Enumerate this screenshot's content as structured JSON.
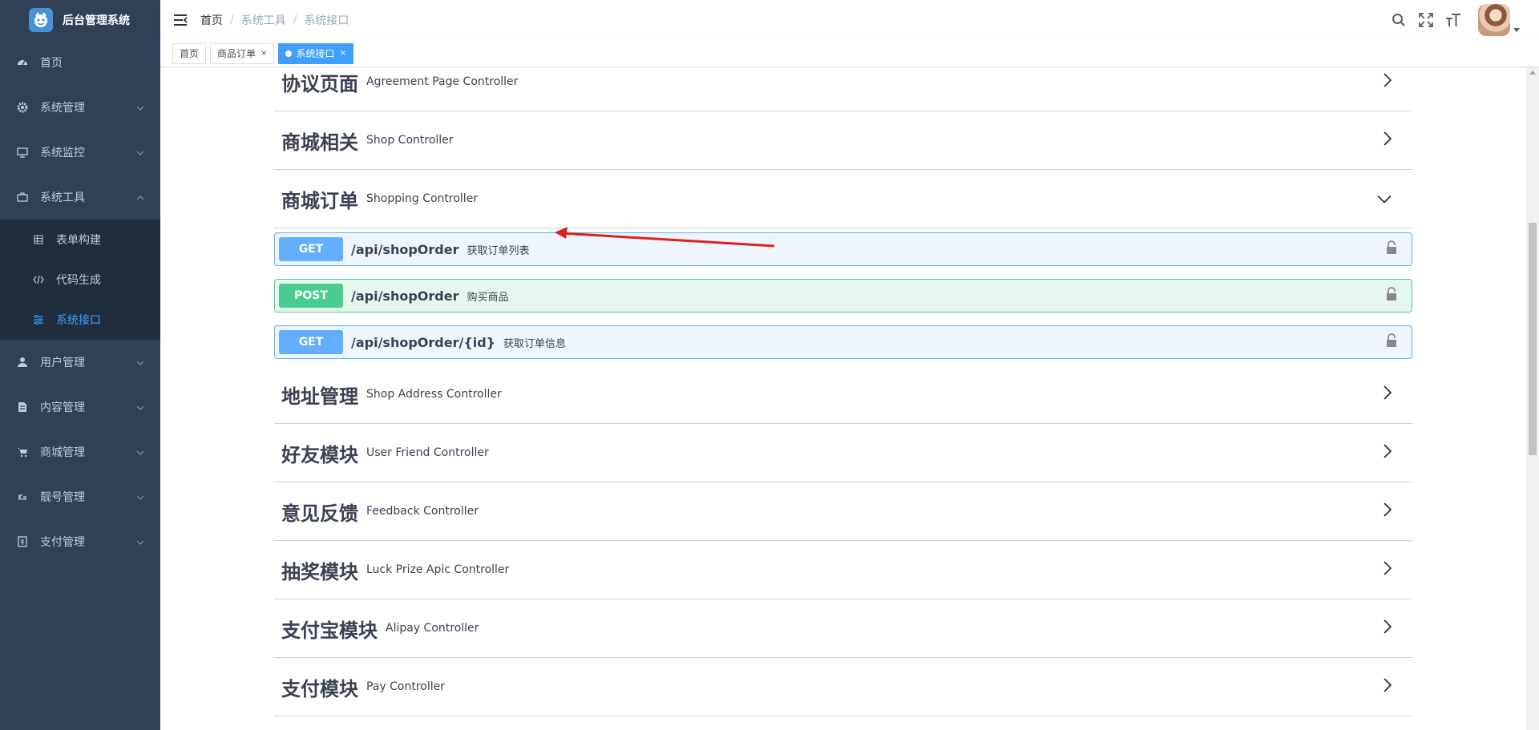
{
  "sidebar": {
    "logo_title": "后台管理系统",
    "items": [
      {
        "label": "首页",
        "icon": "dashboard-icon"
      },
      {
        "label": "系统管理",
        "icon": "gear-icon"
      },
      {
        "label": "系统监控",
        "icon": "monitor-icon"
      },
      {
        "label": "系统工具",
        "icon": "toolbox-icon",
        "expanded": true
      },
      {
        "label": "用户管理",
        "icon": "user-icon"
      },
      {
        "label": "内容管理",
        "icon": "document-icon"
      },
      {
        "label": "商城管理",
        "icon": "cart-icon"
      },
      {
        "label": "靓号管理",
        "icon": "badge-icon"
      },
      {
        "label": "支付管理",
        "icon": "payment-icon"
      }
    ],
    "sub_items": [
      {
        "label": "表单构建",
        "icon": "table-icon"
      },
      {
        "label": "代码生成",
        "icon": "code-icon"
      },
      {
        "label": "系统接口",
        "icon": "sliders-icon",
        "active": true
      }
    ]
  },
  "header": {
    "breadcrumb": [
      "首页",
      "系统工具",
      "系统接口"
    ]
  },
  "tags": [
    {
      "label": "首页"
    },
    {
      "label": "商品订单",
      "close": "×"
    },
    {
      "label": "系统接口",
      "close": "×",
      "active": true
    }
  ],
  "api": {
    "top_section": {
      "zh": "协议页面",
      "en": "Agreement Page Controller"
    },
    "sections_before": [
      {
        "zh": "商城相关",
        "en": "Shop Controller"
      }
    ],
    "expanded_section": {
      "zh": "商城订单",
      "en": "Shopping Controller"
    },
    "endpoints": [
      {
        "method": "GET",
        "path": "/api/shopOrder",
        "summary": "获取订单列表"
      },
      {
        "method": "POST",
        "path": "/api/shopOrder",
        "summary": "购买商品"
      },
      {
        "method": "GET",
        "path": "/api/shopOrder/{id}",
        "summary": "获取订单信息"
      }
    ],
    "sections_after": [
      {
        "zh": "地址管理",
        "en": "Shop Address Controller"
      },
      {
        "zh": "好友模块",
        "en": "User Friend Controller"
      },
      {
        "zh": "意见反馈",
        "en": "Feedback Controller"
      },
      {
        "zh": "抽奖模块",
        "en": "Luck Prize Apic Controller"
      },
      {
        "zh": "支付宝模块",
        "en": "Alipay Controller"
      },
      {
        "zh": "支付模块",
        "en": "Pay Controller"
      }
    ]
  },
  "colors": {
    "sidebar_bg": "#304156",
    "submenu_bg": "#1f2d3d",
    "active": "#409eff",
    "get": "#61affe",
    "post": "#49cc90",
    "annotation_arrow": "#e02020"
  }
}
